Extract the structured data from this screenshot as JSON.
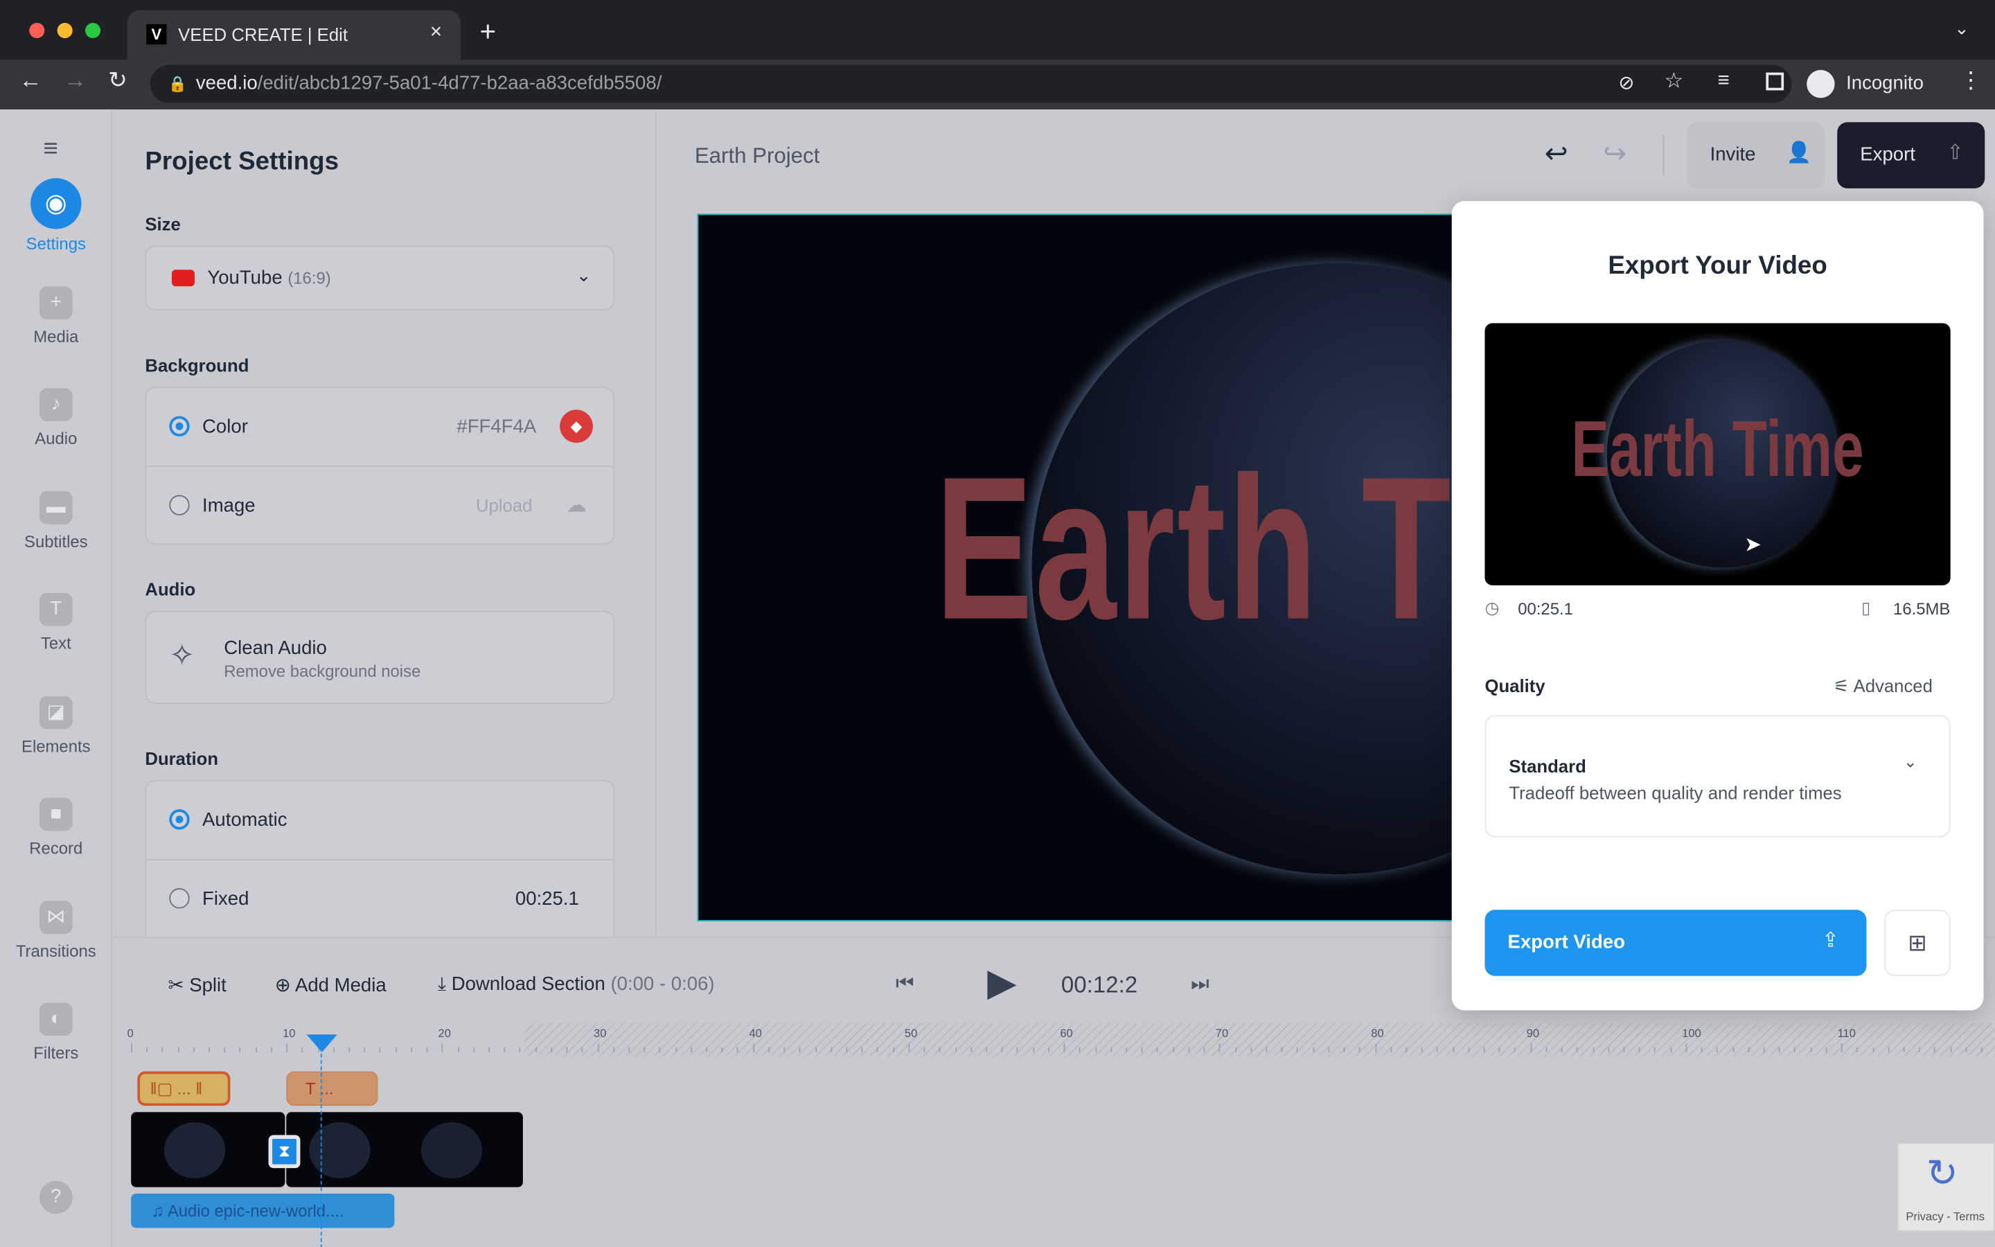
{
  "browser": {
    "tab_title": "VEED CREATE | Edit",
    "url_host": "veed.io",
    "url_path": "/edit/abcb1297-5a01-4d77-b2aa-a83cefdb5508/",
    "profile": "Incognito"
  },
  "rail": {
    "items": [
      {
        "label": "Settings",
        "icon": "settings-icon",
        "active": true
      },
      {
        "label": "Media",
        "icon": "plus-icon"
      },
      {
        "label": "Audio",
        "icon": "music-icon"
      },
      {
        "label": "Subtitles",
        "icon": "subtitles-icon"
      },
      {
        "label": "Text",
        "icon": "text-icon"
      },
      {
        "label": "Elements",
        "icon": "elements-icon"
      },
      {
        "label": "Record",
        "icon": "record-icon"
      },
      {
        "label": "Transitions",
        "icon": "transitions-icon"
      },
      {
        "label": "Filters",
        "icon": "filters-icon"
      }
    ],
    "help": "?"
  },
  "settings": {
    "title": "Project Settings",
    "size_label": "Size",
    "size_value": "YouTube",
    "size_ratio": "(16:9)",
    "background_label": "Background",
    "color_label": "Color",
    "color_value": "#FF4F4A",
    "image_label": "Image",
    "upload_label": "Upload",
    "audio_label": "Audio",
    "clean_audio_title": "Clean Audio",
    "clean_audio_desc": "Remove background noise",
    "duration_label": "Duration",
    "automatic_label": "Automatic",
    "fixed_label": "Fixed",
    "fixed_value": "00:25.1"
  },
  "header": {
    "project_name": "Earth Project",
    "invite": "Invite",
    "export": "Export"
  },
  "canvas": {
    "title_text": "Earth Time"
  },
  "export": {
    "title": "Export Your Video",
    "preview_text": "Earth Time",
    "duration": "00:25.1",
    "file_size": "16.5MB",
    "quality_label": "Quality",
    "advanced": "Advanced",
    "quality_value": "Standard",
    "quality_desc": "Tradeoff between quality and render times",
    "export_button": "Export Video"
  },
  "timeline": {
    "split": "Split",
    "add_media": "Add Media",
    "download": "Download Section",
    "download_range": "(0:00 - 0:06)",
    "time": "00:12:2",
    "ticks": [
      "0",
      "10",
      "20",
      "30",
      "40",
      "50",
      "60",
      "70",
      "80",
      "90",
      "100",
      "110"
    ],
    "text_clip": "T ...",
    "element_clip": "...",
    "audio_clip": "Audio epic-new-world...."
  },
  "recaptcha": "Privacy - Terms",
  "colors": {
    "accent": "#1e88e5",
    "export_dark": "#1a1d2b",
    "brand_red": "#FF4F4A"
  }
}
